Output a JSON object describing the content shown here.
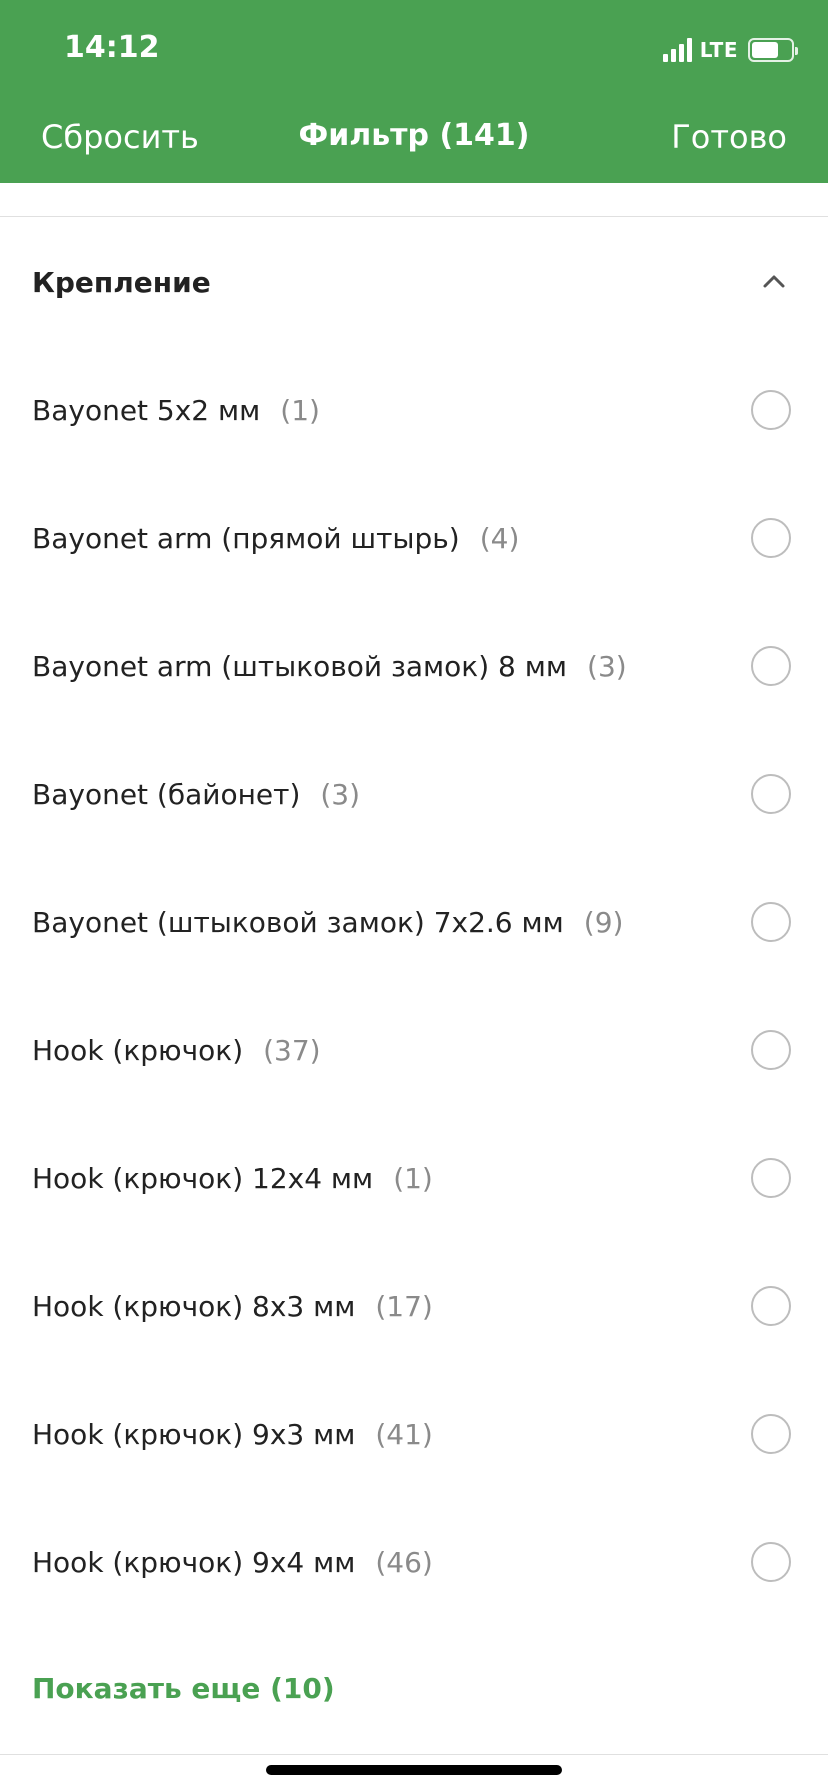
{
  "status_bar": {
    "time": "14:12",
    "network": "LTE"
  },
  "nav": {
    "reset_label": "Сбросить",
    "title": "Фильтр (141)",
    "done_label": "Готово"
  },
  "section": {
    "title": "Крепление",
    "expanded": true
  },
  "options": [
    {
      "label": "Bayonet 5x2 мм",
      "count": "(1)",
      "selected": false
    },
    {
      "label": "Bayonet arm (прямой штырь)",
      "count": "(4)",
      "selected": false
    },
    {
      "label": "Bayonet arm (штыковой замок) 8 мм",
      "count": "(3)",
      "selected": false
    },
    {
      "label": "Bayonet (байонет)",
      "count": "(3)",
      "selected": false
    },
    {
      "label": "Bayonet (штыковой замок) 7x2.6 мм",
      "count": "(9)",
      "selected": false
    },
    {
      "label": "Hook (крючок)",
      "count": "(37)",
      "selected": false
    },
    {
      "label": "Hook (крючок) 12x4 мм",
      "count": "(1)",
      "selected": false
    },
    {
      "label": "Hook (крючок) 8x3 мм",
      "count": "(17)",
      "selected": false
    },
    {
      "label": "Hook (крючок) 9x3 мм",
      "count": "(41)",
      "selected": false
    },
    {
      "label": "Hook (крючок) 9x4 мм",
      "count": "(46)",
      "selected": false
    }
  ],
  "show_more_label": "Показать еще (10)",
  "colors": {
    "header_bg": "#4aa152",
    "accent": "#4aa152",
    "count_text": "#8a8a8a",
    "radio_border": "#bdbdbd"
  }
}
